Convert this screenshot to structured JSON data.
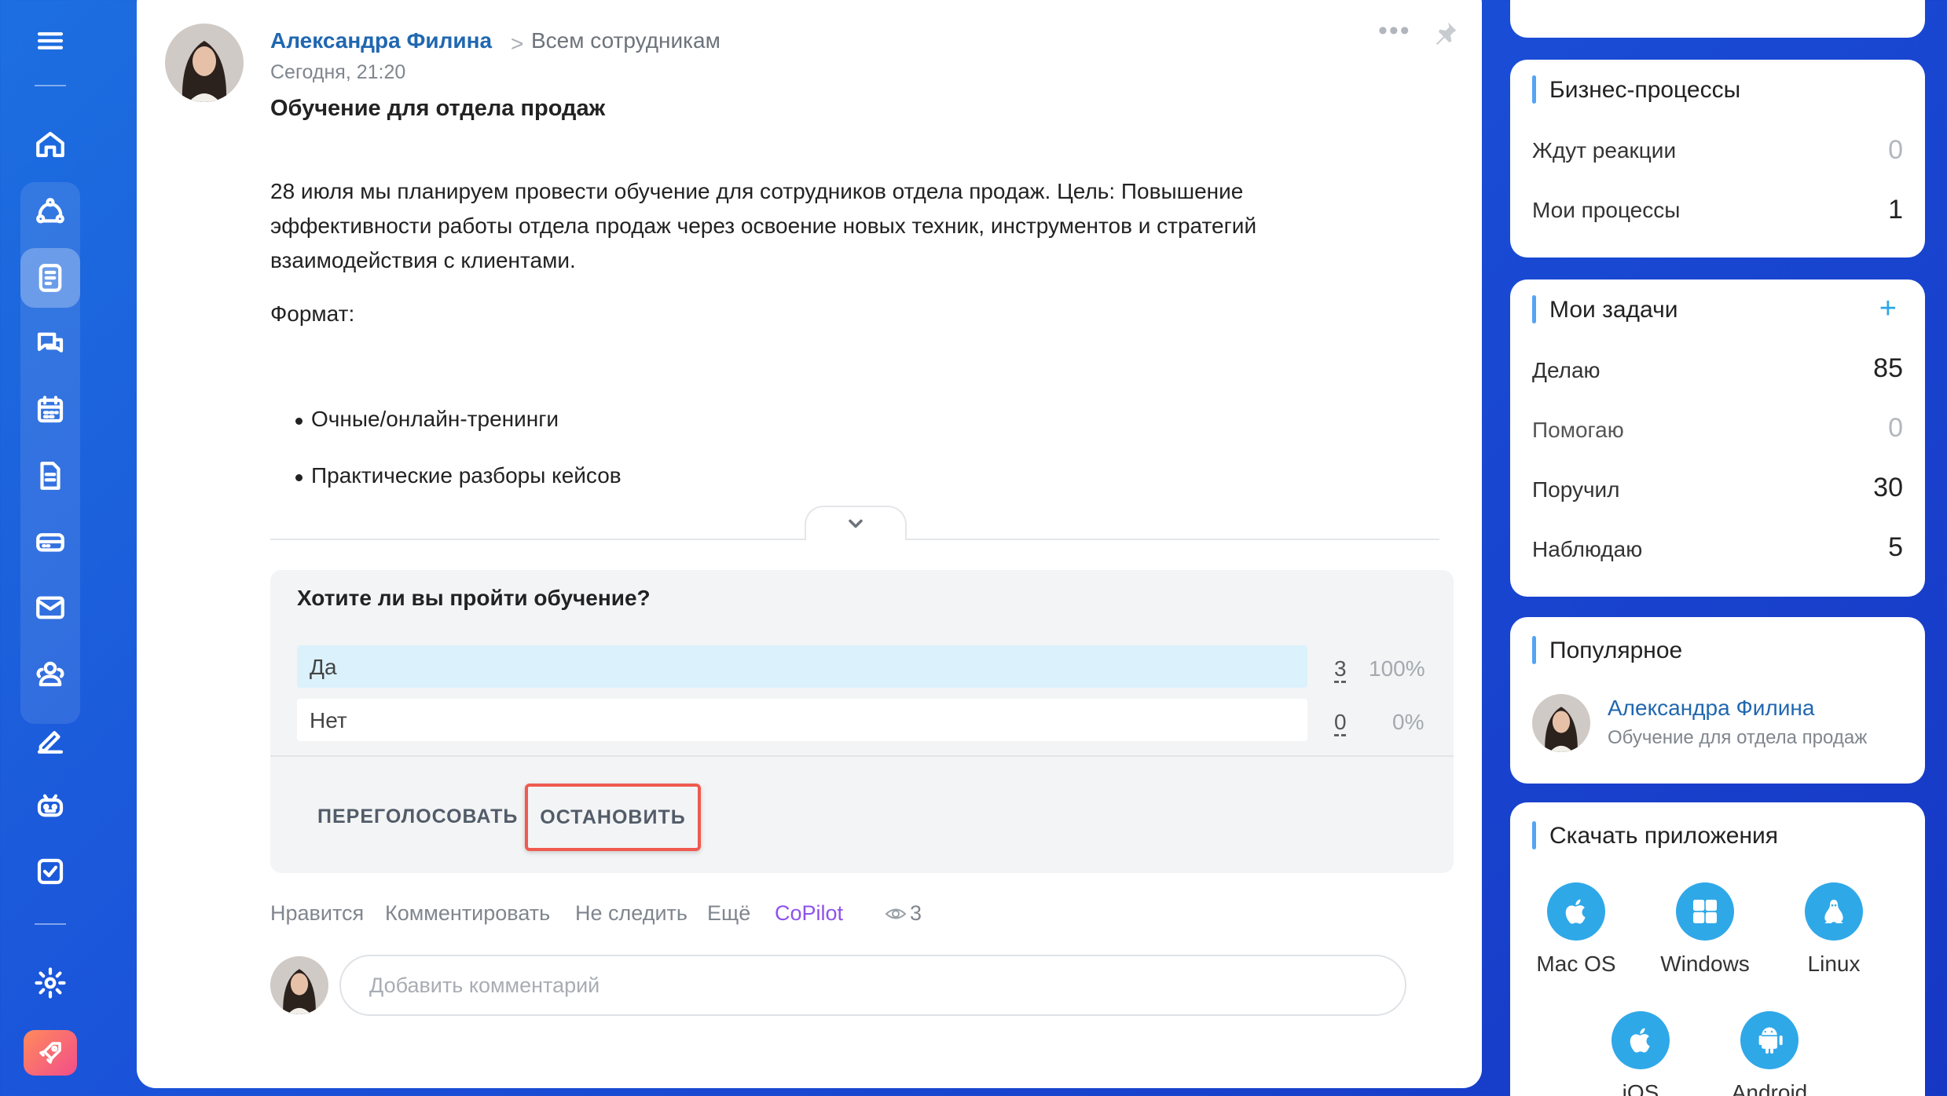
{
  "post": {
    "author": "Александра Филина",
    "arrow": ">",
    "destination": "Всем сотрудникам",
    "time": "Сегодня, 21:20",
    "title": "Обучение для отдела продаж",
    "body": "28 июля мы планируем провести обучение для сотрудников отдела продаж. Цель: Повышение эффективности работы отдела продаж через освоение новых техник, инструментов и стратегий взаимодействия с клиентами.",
    "format_label": "Формат:",
    "bullets": [
      "Очные/онлайн-тренинги",
      "Практические разборы кейсов"
    ],
    "more_dots": "•••"
  },
  "poll": {
    "question": "Хотите ли вы пройти обучение?",
    "options": [
      {
        "label": "Да",
        "count": "3",
        "percent": "100%"
      },
      {
        "label": "Нет",
        "count": "0",
        "percent": "0%"
      }
    ],
    "revote_label": "ПЕРЕГОЛОСОВАТЬ",
    "stop_label": "ОСТАНОВИТЬ"
  },
  "actions": {
    "like": "Нравится",
    "comment": "Комментировать",
    "unfollow": "Не следить",
    "more": "Ещё",
    "copilot": "CoPilot",
    "views": "3"
  },
  "comment_box": {
    "placeholder": "Добавить комментарий"
  },
  "widgets": {
    "business": {
      "title": "Бизнес-процессы",
      "rows": [
        {
          "label": "Ждут реакции",
          "value": "0"
        },
        {
          "label": "Мои процессы",
          "value": "1"
        }
      ]
    },
    "tasks": {
      "title": "Мои задачи",
      "plus": "+",
      "rows": [
        {
          "label": "Делаю",
          "value": "85"
        },
        {
          "label": "Помогаю",
          "value": "0"
        },
        {
          "label": "Поручил",
          "value": "30"
        },
        {
          "label": "Наблюдаю",
          "value": "5"
        }
      ]
    },
    "popular": {
      "title": "Популярное",
      "name": "Александра Филина",
      "subtitle": "Обучение для отдела продаж"
    },
    "apps": {
      "title": "Скачать приложения",
      "items": [
        "Mac OS",
        "Windows",
        "Linux",
        "iOS",
        "Android"
      ]
    }
  },
  "colors": {
    "accent_link": "#2067b0",
    "copilot": "#8e52ec",
    "highlight": "#ef5a4f",
    "poll_winner": "#dbf1fc"
  }
}
